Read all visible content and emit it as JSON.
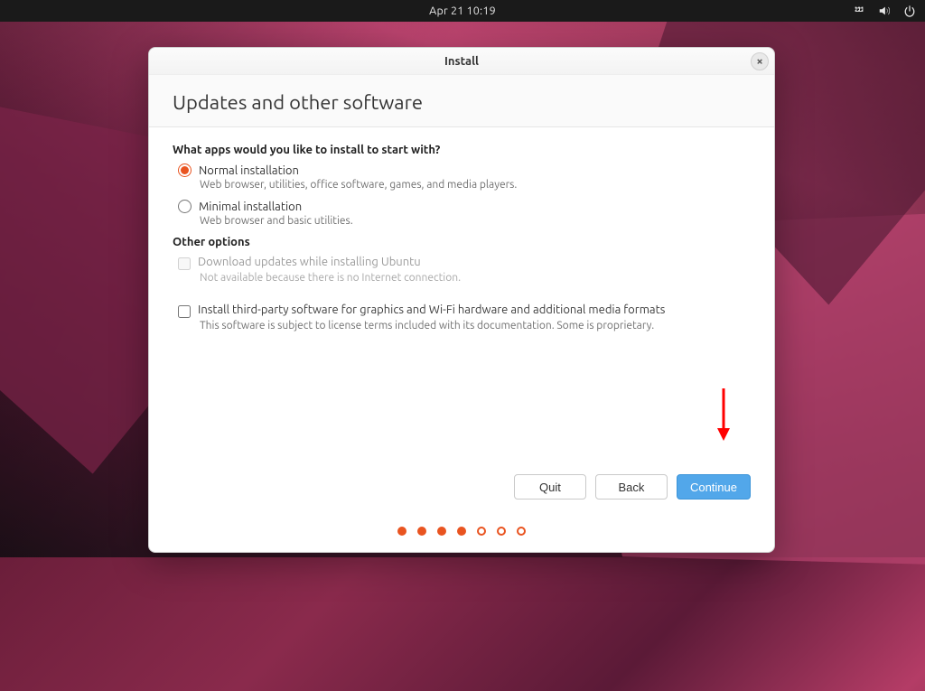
{
  "topbar": {
    "datetime": "Apr 21  10:19"
  },
  "modal": {
    "title": "Install",
    "heading": "Updates and other software",
    "question": "What apps would you like to install to start with?",
    "options": {
      "normal_label": "Normal installation",
      "normal_desc": "Web browser, utilities, office software, games, and media players.",
      "minimal_label": "Minimal installation",
      "minimal_desc": "Web browser and basic utilities."
    },
    "other_heading": "Other options",
    "checkboxes": {
      "download_label": "Download updates while installing Ubuntu",
      "download_note": "Not available because there is no Internet connection.",
      "thirdparty_label": "Install third-party software for graphics and Wi-Fi hardware and additional media formats",
      "thirdparty_note": "This software is subject to license terms included with its documentation. Some is proprietary."
    },
    "buttons": {
      "quit": "Quit",
      "back": "Back",
      "continue": "Continue"
    },
    "progress": {
      "total": 7,
      "current": 4
    }
  }
}
